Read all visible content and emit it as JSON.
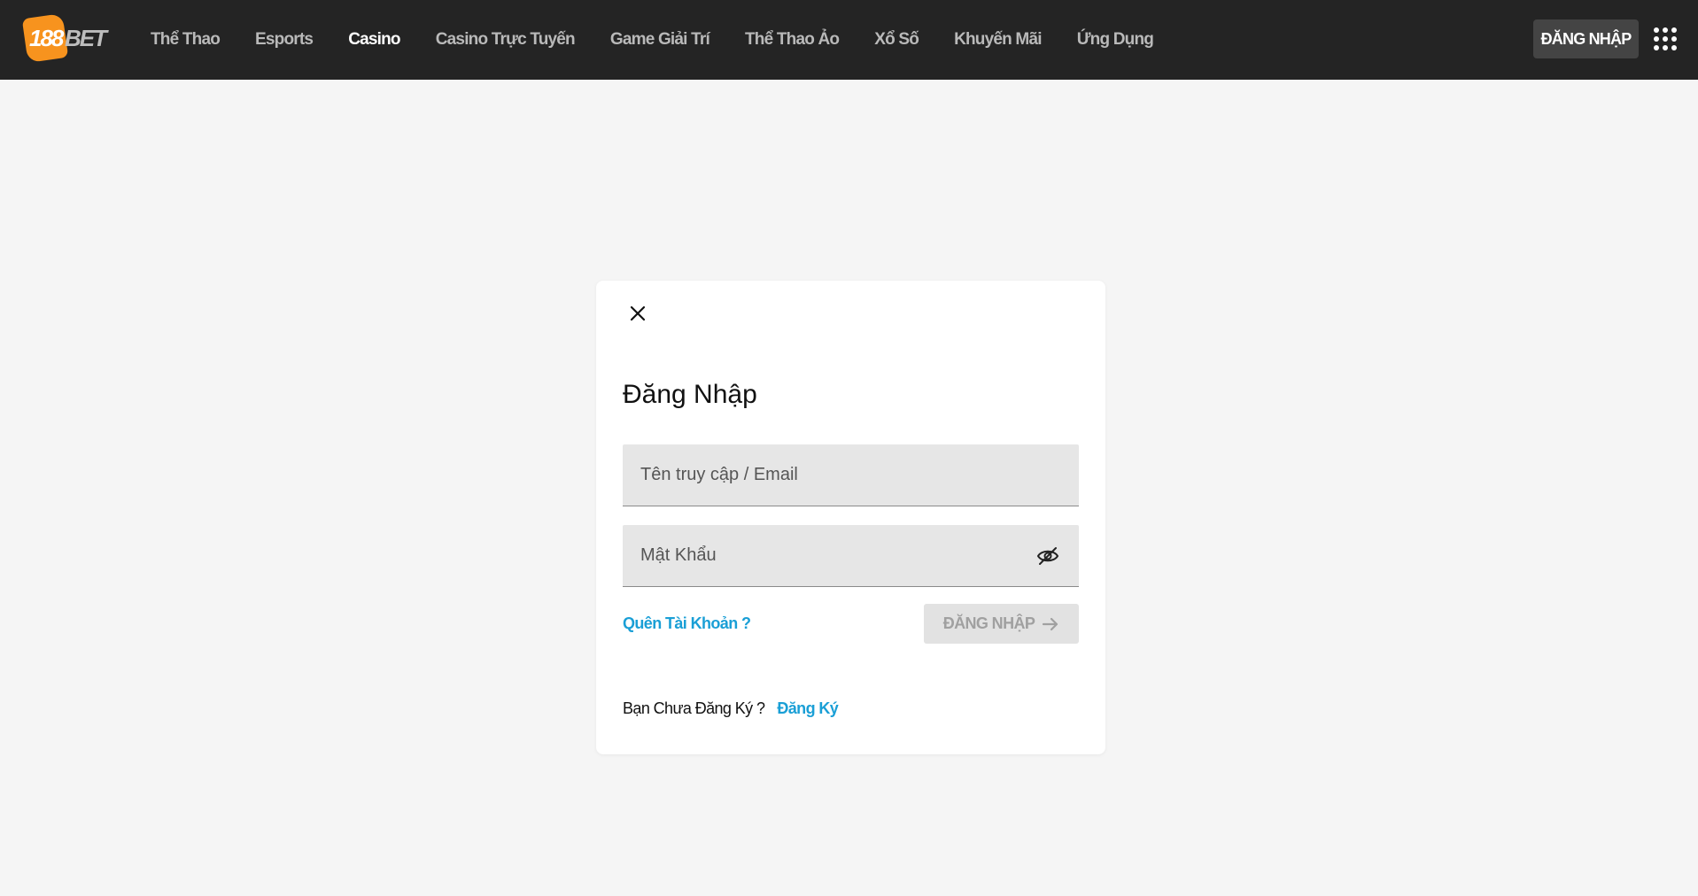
{
  "brand": {
    "logo_number": "188",
    "logo_text": "BET",
    "accent": "#f7931e"
  },
  "nav": {
    "items": [
      {
        "label": "Thể Thao",
        "active": false
      },
      {
        "label": "Esports",
        "active": false
      },
      {
        "label": "Casino",
        "active": true
      },
      {
        "label": "Casino Trực Tuyến",
        "active": false
      },
      {
        "label": "Game Giải Trí",
        "active": false
      },
      {
        "label": "Thể Thao Ảo",
        "active": false
      },
      {
        "label": "Xổ Số",
        "active": false
      },
      {
        "label": "Khuyến Mãi",
        "active": false
      },
      {
        "label": "Ứng Dụng",
        "active": false
      }
    ],
    "login_label": "ĐĂNG NHẬP",
    "menu_icon": "grid-menu-icon"
  },
  "login_modal": {
    "close_icon": "close-icon",
    "title": "Đăng Nhập",
    "username_placeholder": "Tên truy cập / Email",
    "password_placeholder": "Mật Khẩu",
    "password_toggle_icon": "eye-slash-icon",
    "forgot_label": "Quên Tài Khoản ?",
    "submit_label": "ĐĂNG NHẬP",
    "submit_icon": "arrow-right-icon",
    "signup_question": "Bạn Chưa Đăng Ký ?",
    "signup_link": "Đăng Ký",
    "link_color": "#1a9fd6"
  }
}
